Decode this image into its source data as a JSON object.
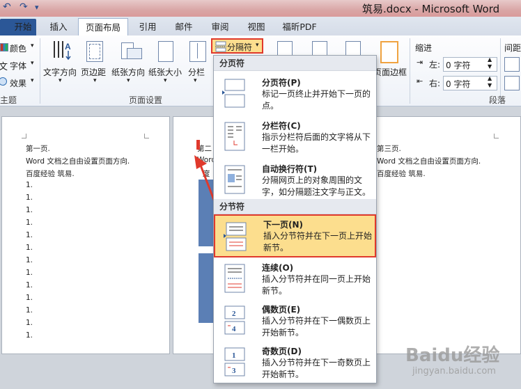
{
  "window": {
    "title": "筑易.docx - Microsoft Word"
  },
  "tabs": [
    {
      "label": "开始"
    },
    {
      "label": "插入"
    },
    {
      "label": "页面布局"
    },
    {
      "label": "引用"
    },
    {
      "label": "邮件"
    },
    {
      "label": "审阅"
    },
    {
      "label": "视图"
    },
    {
      "label": "福昕PDF"
    }
  ],
  "ribbon": {
    "theme": {
      "colors": "颜色",
      "fonts": "字体",
      "effects": "效果",
      "group_label": "主题"
    },
    "page_setup": {
      "text_direction": "文字方向",
      "margins": "页边距",
      "orientation": "纸张方向",
      "size": "纸张大小",
      "columns": "分栏",
      "group_label": "页面设置"
    },
    "breaks_button": "分隔符",
    "page_border": "页面边框",
    "paragraph": {
      "indent_label": "缩进",
      "spacing_label": "间距",
      "left_label": "左:",
      "right_label": "右:",
      "left_value": "0 字符",
      "right_value": "0 字符",
      "group_label": "段落"
    }
  },
  "breaks_menu": {
    "page_breaks_header": "分页符",
    "section_breaks_header": "分节符",
    "items": [
      {
        "title": "分页符(P)",
        "desc": "标记一页终止并开始下一页的点。"
      },
      {
        "title": "分栏符(C)",
        "desc": "指示分栏符后面的文字将从下一栏开始。"
      },
      {
        "title": "自动换行符(T)",
        "desc": "分隔网页上的对象周围的文字，如分隔题注文字与正文。"
      },
      {
        "title": "下一页(N)",
        "desc": "插入分节符并在下一页上开始新节。"
      },
      {
        "title": "连续(O)",
        "desc": "插入分节符并在同一页上开始新节。"
      },
      {
        "title": "偶数页(E)",
        "desc": "插入分节符并在下一偶数页上开始新节。"
      },
      {
        "title": "奇数页(D)",
        "desc": "插入分节符并在下一奇数页上开始新节。"
      }
    ]
  },
  "doc": {
    "page1": {
      "line1": "第一页.",
      "line2": "Word 文档之自由设置页面方向.",
      "line3": "百度经验  筑易.",
      "list_marker": "1."
    },
    "page2": {
      "line1": "第二",
      "line2": "Word",
      "line3": "度"
    },
    "page3": {
      "line1": "第三页.",
      "line2": "Word 文档之自由设置页面方向.",
      "line3": "百度经验  筑易."
    }
  },
  "watermark": {
    "brand": "Baidu经验",
    "url": "jingyan.baidu.com"
  },
  "colors": {
    "highlight": "#fcde8e",
    "annotation": "#e0392c",
    "file_tab": "#2b5797"
  }
}
